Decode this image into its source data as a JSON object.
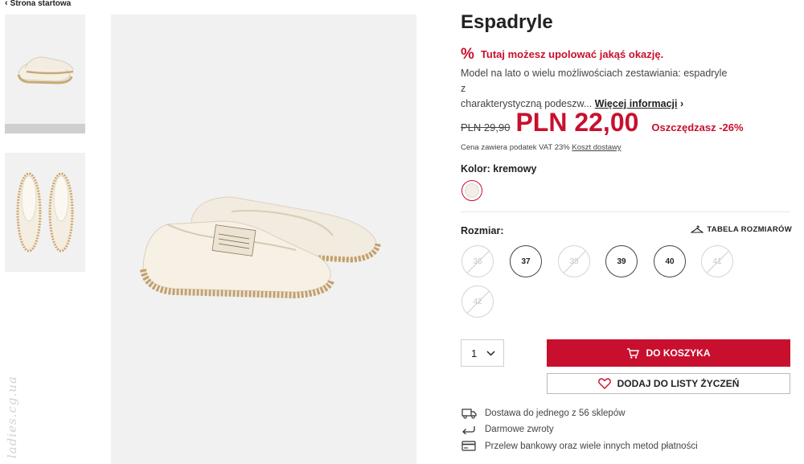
{
  "breadcrumb": {
    "label": "Strona startowa"
  },
  "product": {
    "title": "Espadryle",
    "promo": "Tutaj możesz upolować jakąś okazję.",
    "promo_icon": "percent-icon",
    "description_line1": "Model na lato o wielu możliwościach zestawiania: espadryle z",
    "description_line2": "charakterystyczną podeszw...",
    "more_info": "Więcej informacji"
  },
  "price": {
    "old": "PLN 29,90",
    "new": "PLN 22,00",
    "savings": "Oszczędzasz -26%",
    "vat_text": "Cena zawiera podatek VAT 23%",
    "shipping_link": "Koszt dostawy"
  },
  "color": {
    "label": "Kolor: kremowy",
    "swatch_hex": "#f3eee6"
  },
  "size": {
    "label": "Rozmiar:",
    "table_label": "TABELA ROZMIARÓW",
    "options": [
      {
        "label": "36",
        "available": false
      },
      {
        "label": "37",
        "available": true
      },
      {
        "label": "38",
        "available": false
      },
      {
        "label": "39",
        "available": true
      },
      {
        "label": "40",
        "available": true
      },
      {
        "label": "41",
        "available": false
      },
      {
        "label": "42",
        "available": false
      }
    ]
  },
  "quantity": {
    "value": "1"
  },
  "buttons": {
    "cart": "DO KOSZYKA",
    "wishlist": "DODAJ DO LISTY ŻYCZEŃ"
  },
  "info": {
    "delivery": "Dostawa do jednego z 56 sklepów",
    "returns": "Darmowe zwroty",
    "payment": "Przelew bankowy oraz wiele innych metod płatności"
  },
  "watermark": "ladies.cg.ua",
  "colors": {
    "accent": "#c8102e",
    "image_bg": "#f1f1f1"
  }
}
